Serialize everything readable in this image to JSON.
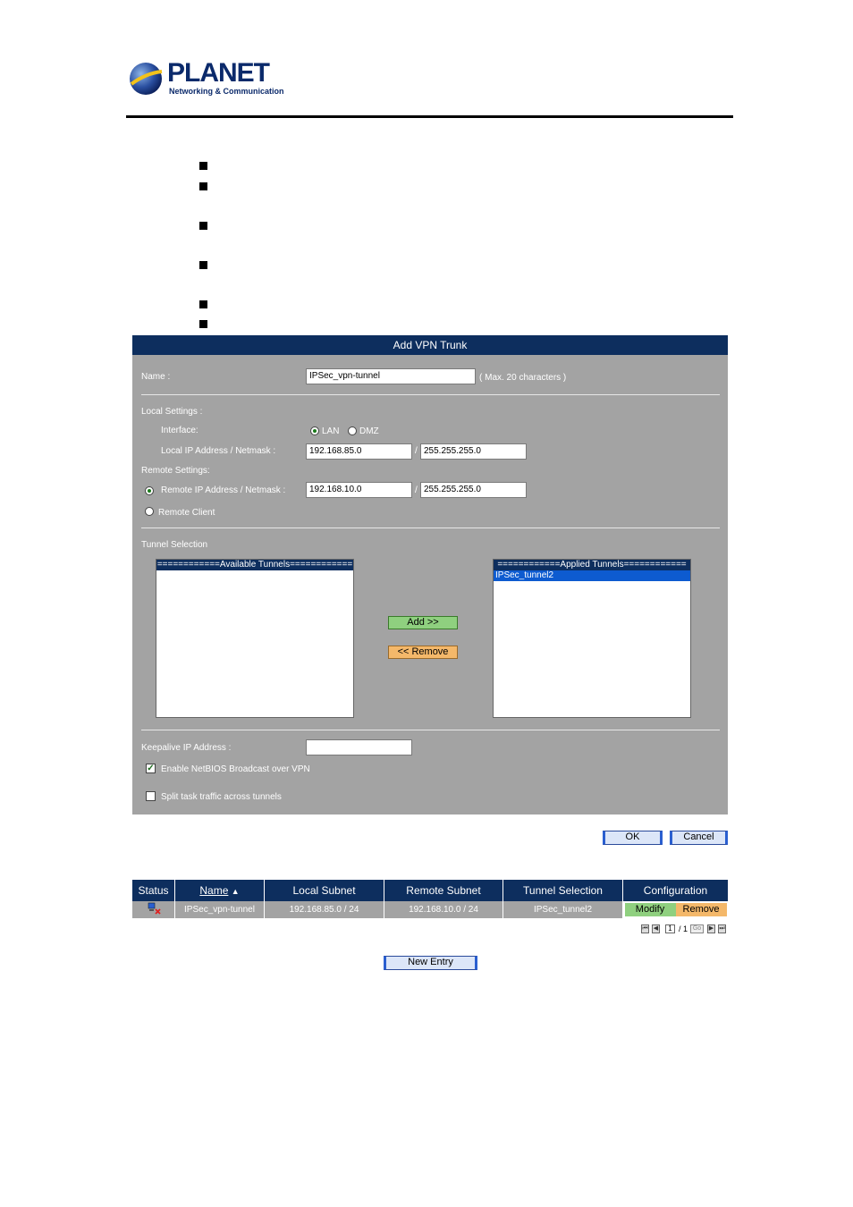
{
  "header": {
    "brand": "PLANET",
    "tagline": "Networking & Communication"
  },
  "panel": {
    "title": "Add VPN Trunk",
    "name_label": "Name :",
    "name_value": "IPSec_vpn-tunnel",
    "name_hint": "( Max. 20 characters )",
    "local_settings_label": "Local Settings :",
    "interface_label": "Interface:",
    "interface_options": [
      "LAN",
      "DMZ"
    ],
    "interface_selected": "LAN",
    "local_ip_label": "Local IP Address / Netmask :",
    "local_ip": "192.168.85.0",
    "local_mask": "255.255.255.0",
    "slash": "/",
    "remote_settings_label": "Remote Settings:",
    "remote_ip_label": "Remote IP Address / Netmask :",
    "remote_ip": "192.168.10.0",
    "remote_mask": "255.255.255.0",
    "remote_client_label": "Remote Client",
    "tunnel_selection_label": "Tunnel Selection",
    "available_header": "============Available Tunnels============",
    "applied_header": "============Applied Tunnels============",
    "applied_items": [
      "IPSec_tunnel2"
    ],
    "add_button": "Add >>",
    "remove_button": "<< Remove",
    "keepalive_label": "Keepalive IP Address :",
    "keepalive_value": "",
    "netbios_label": "Enable NetBIOS Broadcast over VPN",
    "netbios_checked": true,
    "split_label": "Split task traffic across tunnels",
    "split_checked": false
  },
  "actions": {
    "ok": "OK",
    "cancel": "Cancel"
  },
  "table": {
    "headers": [
      "Status",
      "Name",
      "Local Subnet",
      "Remote Subnet",
      "Tunnel Selection",
      "Configuration"
    ],
    "rows": [
      {
        "name": "IPSec_vpn-tunnel",
        "local_subnet": "192.168.85.0 / 24",
        "remote_subnet": "192.168.10.0 / 24",
        "tunnel_selection": "IPSec_tunnel2",
        "modify": "Modify",
        "remove": "Remove"
      }
    ]
  },
  "pagination": {
    "page": "1",
    "total": "/ 1",
    "go": "Go"
  },
  "new_entry": "New Entry",
  "colors": {
    "navy": "#0d2e5e",
    "panel_gray": "#a3a3a3",
    "green_button": "#8fd07f",
    "orange_button": "#f4b86a"
  }
}
